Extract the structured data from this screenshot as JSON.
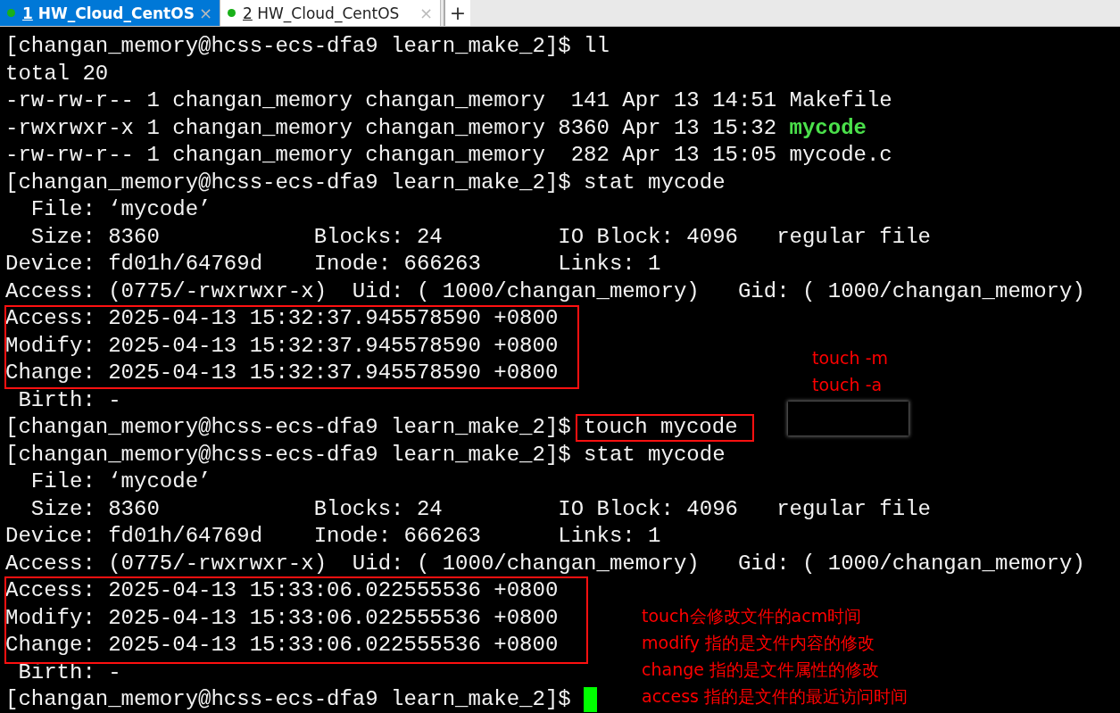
{
  "tabs": [
    {
      "number": "1",
      "label": "HW_Cloud_CentOS",
      "close": "×",
      "selected": true
    },
    {
      "number": "2",
      "label": "HW_Cloud_CentOS",
      "close": "×",
      "selected": false
    }
  ],
  "new_tab": "+",
  "terminal": {
    "lines": [
      {
        "segments": [
          {
            "kind": "text",
            "text": "[changan_memory@hcss-ecs-dfa9 learn_make_2]$ ll"
          }
        ]
      },
      {
        "segments": [
          {
            "kind": "text",
            "text": "total 20"
          }
        ]
      },
      {
        "segments": [
          {
            "kind": "text",
            "text": "-rw-rw-r-- 1 changan_memory changan_memory  141 Apr 13 14:51 Makefile"
          }
        ]
      },
      {
        "segments": [
          {
            "kind": "text",
            "text": "-rwxrwxr-x 1 changan_memory changan_memory 8360 Apr 13 15:32 "
          },
          {
            "kind": "executable",
            "text": "mycode"
          }
        ]
      },
      {
        "segments": [
          {
            "kind": "text",
            "text": "-rw-rw-r-- 1 changan_memory changan_memory  282 Apr 13 15:05 mycode.c"
          }
        ]
      },
      {
        "segments": [
          {
            "kind": "text",
            "text": "[changan_memory@hcss-ecs-dfa9 learn_make_2]$ stat mycode"
          }
        ]
      },
      {
        "segments": [
          {
            "kind": "text",
            "text": "  File: ‘mycode’"
          }
        ]
      },
      {
        "segments": [
          {
            "kind": "text",
            "text": "  Size: 8360            Blocks: 24         IO Block: 4096   regular file"
          }
        ]
      },
      {
        "segments": [
          {
            "kind": "text",
            "text": "Device: fd01h/64769d    Inode: 666263      Links: 1"
          }
        ]
      },
      {
        "segments": [
          {
            "kind": "text",
            "text": "Access: (0775/-rwxrwxr-x)  Uid: ( 1000/changan_memory)   Gid: ( 1000/changan_memory)"
          }
        ]
      },
      {
        "segments": [
          {
            "kind": "text",
            "text": "Access: 2025-04-13 15:32:37.945578590 +0800"
          }
        ]
      },
      {
        "segments": [
          {
            "kind": "text",
            "text": "Modify: 2025-04-13 15:32:37.945578590 +0800"
          }
        ]
      },
      {
        "segments": [
          {
            "kind": "text",
            "text": "Change: 2025-04-13 15:32:37.945578590 +0800"
          }
        ]
      },
      {
        "segments": [
          {
            "kind": "text",
            "text": " Birth: -"
          }
        ]
      },
      {
        "segments": [
          {
            "kind": "text",
            "text": "[changan_memory@hcss-ecs-dfa9 learn_make_2]$"
          },
          {
            "kind": "command",
            "text": "touch mycode"
          }
        ]
      },
      {
        "segments": [
          {
            "kind": "text",
            "text": "[changan_memory@hcss-ecs-dfa9 learn_make_2]$ stat mycode"
          }
        ]
      },
      {
        "segments": [
          {
            "kind": "text",
            "text": "  File: ‘mycode’"
          }
        ]
      },
      {
        "segments": [
          {
            "kind": "text",
            "text": "  Size: 8360            Blocks: 24         IO Block: 4096   regular file"
          }
        ]
      },
      {
        "segments": [
          {
            "kind": "text",
            "text": "Device: fd01h/64769d    Inode: 666263      Links: 1"
          }
        ]
      },
      {
        "segments": [
          {
            "kind": "text",
            "text": "Access: (0775/-rwxrwxr-x)  Uid: ( 1000/changan_memory)   Gid: ( 1000/changan_memory)"
          }
        ]
      },
      {
        "segments": [
          {
            "kind": "text",
            "text": "Access: 2025-04-13 15:33:06.022555536 +0800"
          }
        ]
      },
      {
        "segments": [
          {
            "kind": "text",
            "text": "Modify: 2025-04-13 15:33:06.022555536 +0800"
          }
        ]
      },
      {
        "segments": [
          {
            "kind": "text",
            "text": "Change: 2025-04-13 15:33:06.022555536 +0800"
          }
        ]
      },
      {
        "segments": [
          {
            "kind": "text",
            "text": " Birth: -"
          }
        ]
      },
      {
        "segments": [
          {
            "kind": "text",
            "text": "[changan_memory@hcss-ecs-dfa9 learn_make_2]$ "
          }
        ]
      }
    ]
  },
  "annotations": {
    "side_note": [
      "touch -m",
      "touch -a"
    ],
    "notes": [
      "touch会修改文件的acm时间",
      "modify 指的是文件内容的修改",
      "change 指的是文件属性的修改",
      "access 指的是文件的最近访问时间"
    ]
  }
}
